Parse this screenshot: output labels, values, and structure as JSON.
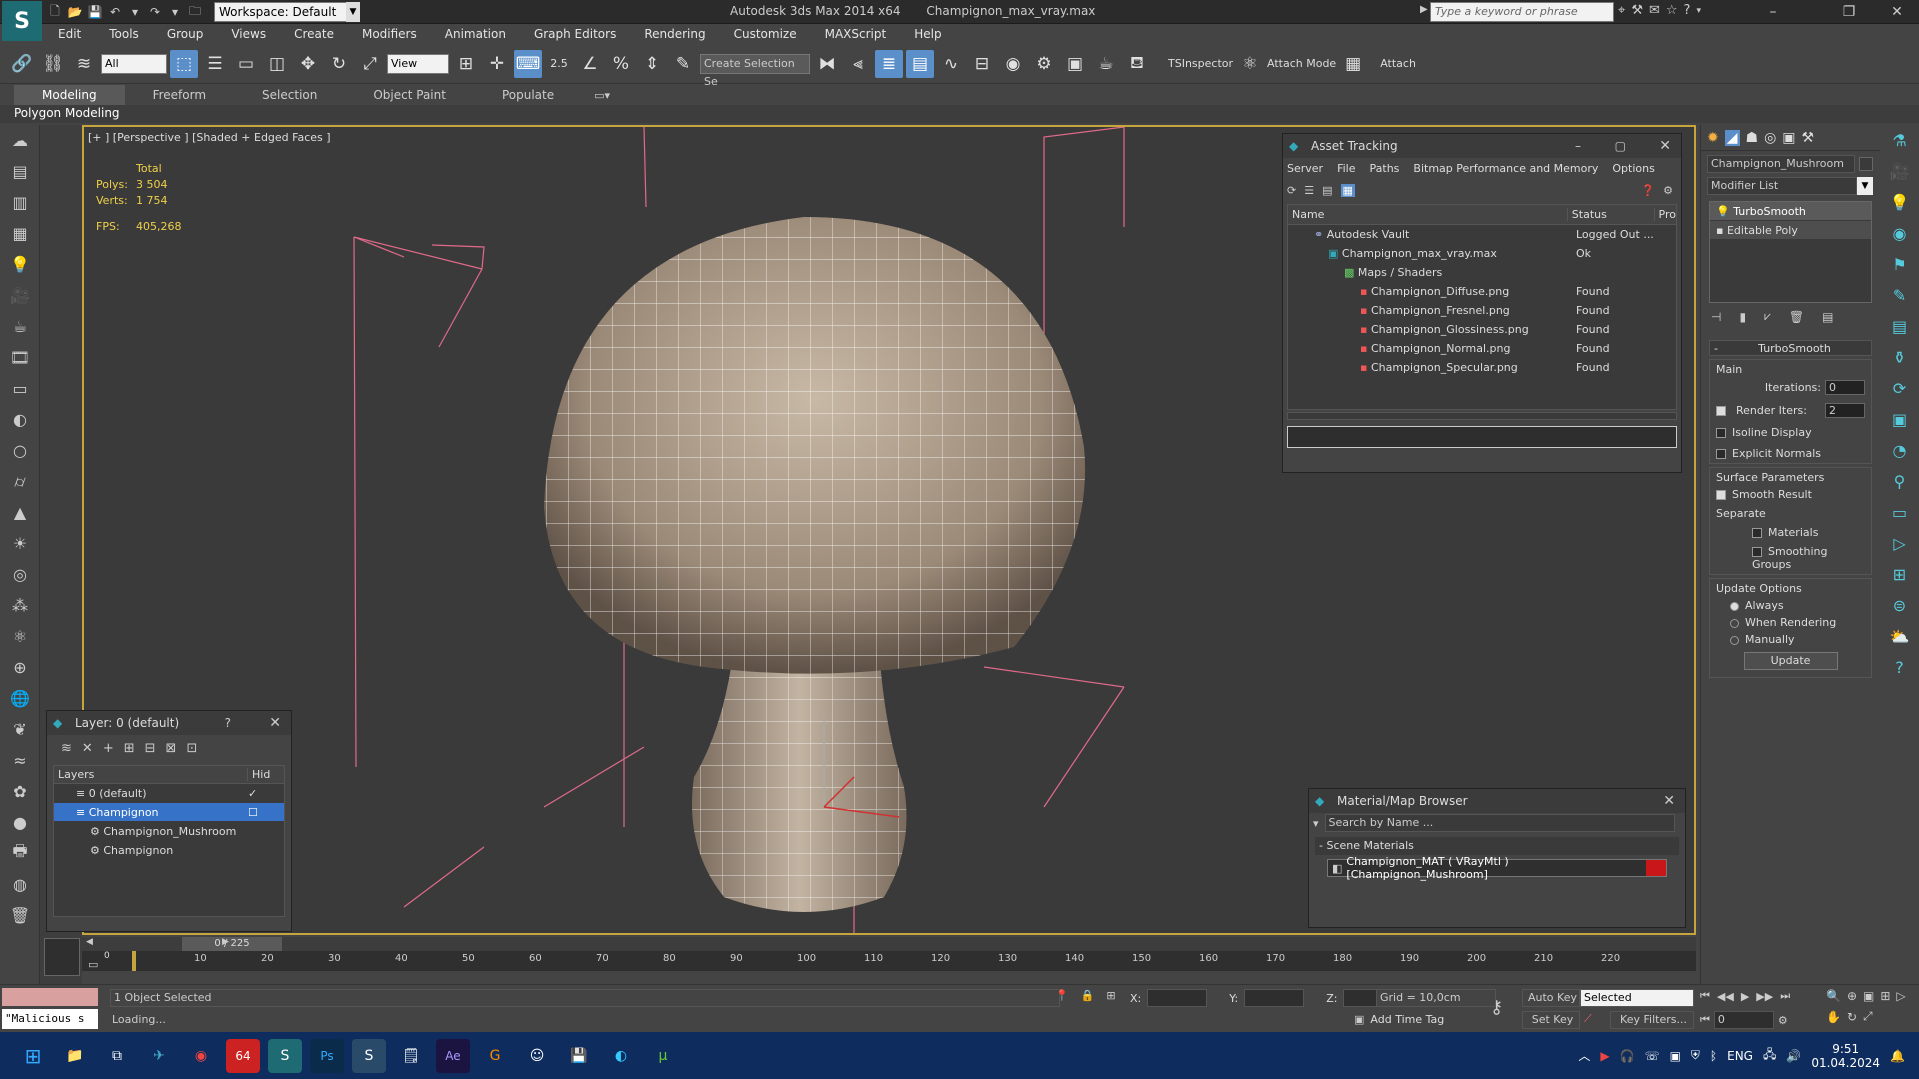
{
  "titlebar": {
    "workspace": "Workspace: Default",
    "app": "Autodesk 3ds Max  2014 x64",
    "file": "Champignon_max_vray.max",
    "search_placeholder": "Type a keyword or phrase"
  },
  "menu": [
    "Edit",
    "Tools",
    "Group",
    "Views",
    "Create",
    "Modifiers",
    "Animation",
    "Graph Editors",
    "Rendering",
    "Customize",
    "MAXScript",
    "Help"
  ],
  "toolbar": {
    "selection_filter": "All",
    "ref_coord": "View",
    "snap_value": "2.5",
    "named_sel": "Create Selection Se",
    "ts_inspector": "TSInspector",
    "attach_mode": "Attach Mode",
    "attach": "Attach"
  },
  "ribbon": {
    "tabs": [
      "Modeling",
      "Freeform",
      "Selection",
      "Object Paint",
      "Populate"
    ],
    "active": "Modeling",
    "subtab": "Polygon Modeling"
  },
  "viewport": {
    "label": "[+ ] [Perspective ] [Shaded + Edged Faces ]",
    "stats_header": "Total",
    "polys_label": "Polys:",
    "polys": "3 504",
    "verts_label": "Verts:",
    "verts": "1 754",
    "fps_label": "FPS:",
    "fps": "405,268"
  },
  "asset_tracking": {
    "title": "Asset Tracking",
    "menu": [
      "Server",
      "File",
      "Paths",
      "Bitmap Performance and Memory",
      "Options"
    ],
    "columns": [
      "Name",
      "Status",
      "Pro"
    ],
    "rows": [
      {
        "name": "Autodesk Vault",
        "status": "Logged Out ...",
        "indent": 0
      },
      {
        "name": "Champignon_max_vray.max",
        "status": "Ok",
        "indent": 1
      },
      {
        "name": "Maps / Shaders",
        "status": "",
        "indent": 2
      },
      {
        "name": "Champignon_Diffuse.png",
        "status": "Found",
        "indent": 3
      },
      {
        "name": "Champignon_Fresnel.png",
        "status": "Found",
        "indent": 3
      },
      {
        "name": "Champignon_Glossiness.png",
        "status": "Found",
        "indent": 3
      },
      {
        "name": "Champignon_Normal.png",
        "status": "Found",
        "indent": 3
      },
      {
        "name": "Champignon_Specular.png",
        "status": "Found",
        "indent": 3
      }
    ]
  },
  "layer_panel": {
    "title": "Layer: 0 (default)",
    "help": "?",
    "col_layers": "Layers",
    "col_hide": "Hid",
    "rows": [
      {
        "name": "0 (default)",
        "indent": 1,
        "selected": false
      },
      {
        "name": "Champignon",
        "indent": 1,
        "selected": true
      },
      {
        "name": "Champignon_Mushroom",
        "indent": 2,
        "selected": false
      },
      {
        "name": "Champignon",
        "indent": 2,
        "selected": false
      }
    ]
  },
  "material_browser": {
    "title": "Material/Map Browser",
    "search_placeholder": "Search by Name ...",
    "group": "- Scene Materials",
    "item": "Champignon_MAT  ( VRayMtl ) [Champignon_Mushroom]"
  },
  "command_panel": {
    "object_name": "Champignon_Mushroom",
    "modifier_list": "Modifier List",
    "stack": [
      "TurboSmooth",
      "Editable Poly"
    ],
    "rollout": "TurboSmooth",
    "main_label": "Main",
    "iterations_label": "Iterations:",
    "iterations": "0",
    "render_iters_label": "Render Iters:",
    "render_iters": "2",
    "isoline": "Isoline Display",
    "explicit_normals": "Explicit Normals",
    "surface_params": "Surface Parameters",
    "smooth_result": "Smooth Result",
    "separate": "Separate",
    "materials": "Materials",
    "smoothing_groups": "Smoothing Groups",
    "update_options": "Update Options",
    "always": "Always",
    "when_rendering": "When Rendering",
    "manually": "Manually",
    "update_btn": "Update"
  },
  "timeline": {
    "frame": "0 / 225",
    "ticks": [
      "0",
      "10",
      "20",
      "30",
      "40",
      "50",
      "60",
      "70",
      "80",
      "90",
      "100",
      "110",
      "120",
      "130",
      "140",
      "150",
      "160",
      "170",
      "180",
      "190",
      "200",
      "210",
      "220"
    ]
  },
  "status": {
    "script": "\"Malicious s",
    "selected": "1 Object Selected",
    "loading": "Loading...",
    "x_label": "X:",
    "y_label": "Y:",
    "z_label": "Z:",
    "grid": "Grid = 10,0cm",
    "add_time_tag": "Add Time Tag",
    "auto_key": "Auto Key",
    "set_key": "Set Key",
    "key_mode": "Selected",
    "key_filters": "Key Filters...",
    "frame_field": "0"
  },
  "taskbar": {
    "lang": "ENG",
    "time": "9:51",
    "date": "01.04.2024",
    "badge": "64"
  },
  "colors": {
    "accent": "#5b8fc9",
    "viewport_border": "#c6a53c",
    "selected_row": "#3572c8",
    "stats_text": "#f0d04a"
  }
}
